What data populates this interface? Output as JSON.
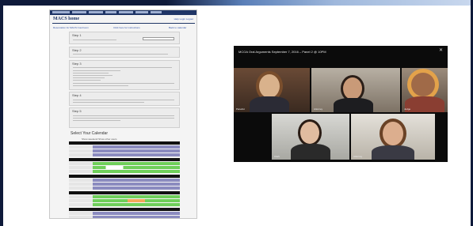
{
  "website": {
    "brand": "MACS home",
    "header_links": "Help   Login   Logout",
    "top_link_left": "Reservation for MACS Courtroom",
    "top_link_mid": "Click here for instructions",
    "top_link_right": "Back to calendar",
    "steps": [
      "Step 1",
      "Step 2",
      "Step 3",
      "Step 4",
      "Step 5"
    ],
    "calendar_title": "Select Your Calendar",
    "calendar_options": "Show weekend   Show other users"
  },
  "video_call": {
    "title": "MCOA Oral Arguments September 7, 2016 – Panel 2 @ 10PM",
    "close_icon": "close-icon",
    "participants": [
      "Panelist",
      "Attorney",
      "Judge",
      "Clerk",
      "Attorney"
    ]
  }
}
